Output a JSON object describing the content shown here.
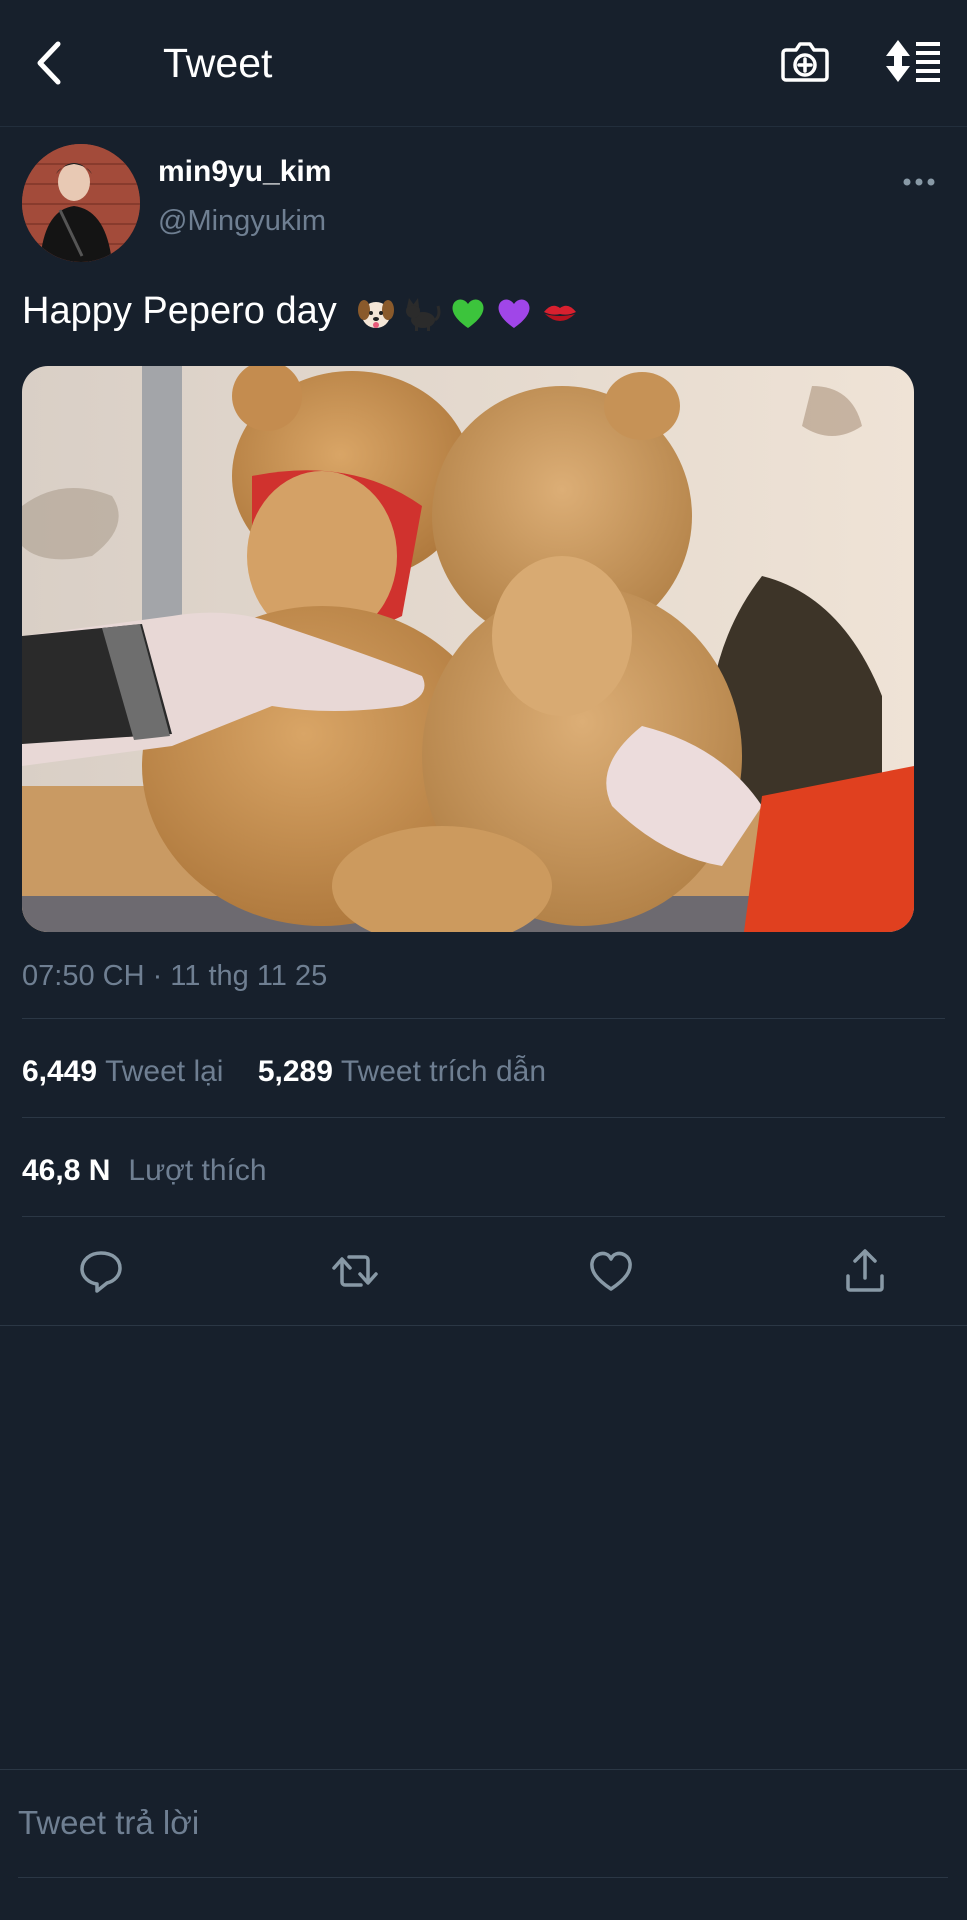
{
  "header": {
    "title": "Tweet",
    "back_icon": "chevron-left-icon",
    "camera_icon": "camera-plus-icon",
    "sort_icon": "sort-list-icon"
  },
  "tweet": {
    "author": {
      "display_name": "min9yu_kim",
      "handle": "@Mingyukim"
    },
    "text": "Happy Pepero day",
    "emojis": [
      "dog-face",
      "black-cat",
      "green-heart",
      "purple-heart",
      "kiss-mark"
    ],
    "timestamp": "07:50 CH · 11 thg 11 25",
    "stats": {
      "retweets": {
        "value": "6,449",
        "label": "Tweet lại"
      },
      "quotes": {
        "value": "5,289",
        "label": "Tweet trích dẫn"
      },
      "likes": {
        "value": "46,8 N",
        "label": "Lượt thích"
      }
    },
    "actions": [
      "reply-icon",
      "retweet-icon",
      "like-icon",
      "share-icon"
    ]
  },
  "reply": {
    "placeholder": "Tweet trả lời"
  },
  "colors": {
    "background": "#17202c",
    "text_primary": "#ffffff",
    "text_secondary": "#6f7f92",
    "divider": "#2b3745",
    "icon": "#8899a6"
  }
}
